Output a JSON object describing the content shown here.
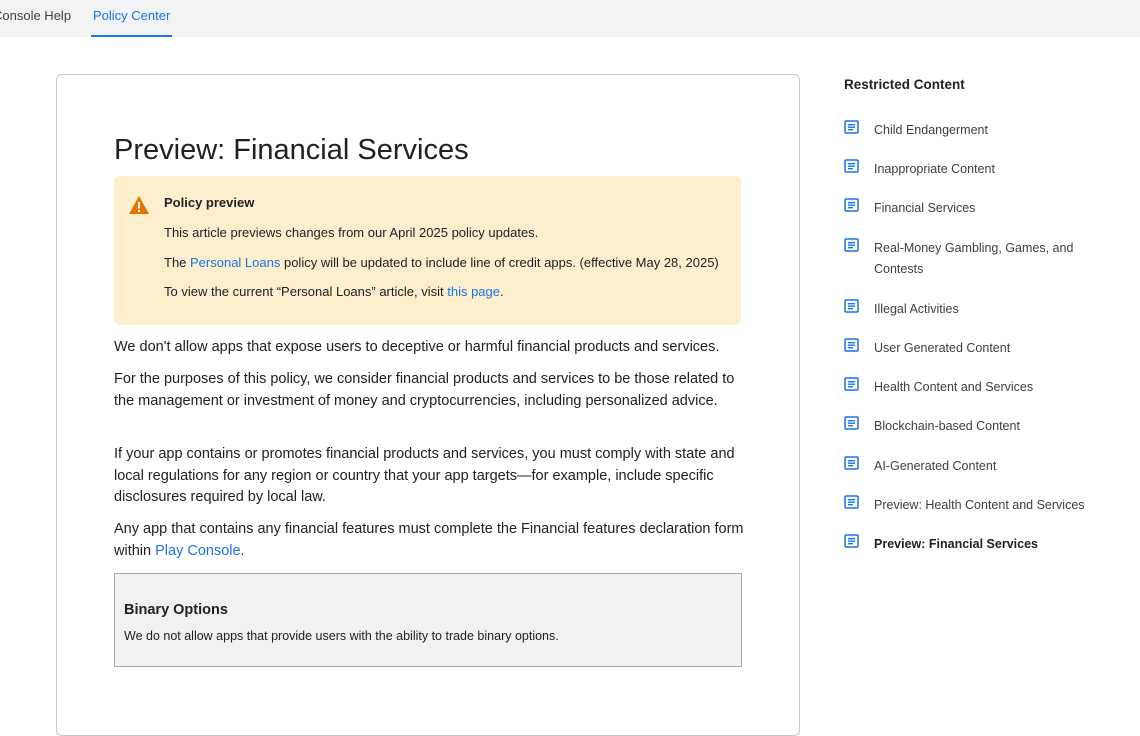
{
  "topbar": {
    "tabs": [
      {
        "label": "Console Help"
      },
      {
        "label": "Policy Center"
      }
    ],
    "accent": "#1a73e8"
  },
  "article": {
    "title": "Preview: Financial Services",
    "notice": {
      "heading": "Policy preview",
      "line1": "This article previews changes from our April 2025 policy updates.",
      "line2_pre": "The ",
      "line2_link": "Personal Loans",
      "line2_post": " policy will be updated to include line of credit apps. (effective May 28, 2025)",
      "line3_pre": "To view the current “Personal Loans” article, visit ",
      "line3_link": "this page",
      "line3_post": ".",
      "icon": "warning-icon",
      "bg_color": "#fdefcd",
      "icon_color": "#e37400"
    },
    "paragraphs": [
      "We don't allow apps that expose users to deceptive or harmful financial products and services.",
      "For the purposes of this policy, we consider financial products and services to be those related to the management or investment of money and cryptocurrencies, including personalized advice.",
      "If your app contains or promotes financial products and services, you must comply with state and local regulations for any region or country that your app targets—for example, include specific disclosures required by local law."
    ],
    "p4_pre": "Any app that contains any financial features must complete the Financial features declaration form within ",
    "p4_link": "Play Console",
    "p4_post": ".",
    "section": {
      "title": "Binary Options",
      "text": "We do not allow apps that provide users with the ability to trade binary options."
    }
  },
  "sidebar": {
    "title": "Restricted Content",
    "icon": "article-icon",
    "items": [
      {
        "label": "Child Endangerment"
      },
      {
        "label": "Inappropriate Content"
      },
      {
        "label": "Financial Services"
      },
      {
        "label": "Real-Money Gambling, Games, and Contests"
      },
      {
        "label": "Illegal Activities"
      },
      {
        "label": "User Generated Content"
      },
      {
        "label": "Health Content and Services"
      },
      {
        "label": "Blockchain-based Content"
      },
      {
        "label": "AI-Generated Content"
      },
      {
        "label": "Preview: Health Content and Services"
      },
      {
        "label": "Preview: Financial Services"
      }
    ],
    "active_index": 10
  }
}
